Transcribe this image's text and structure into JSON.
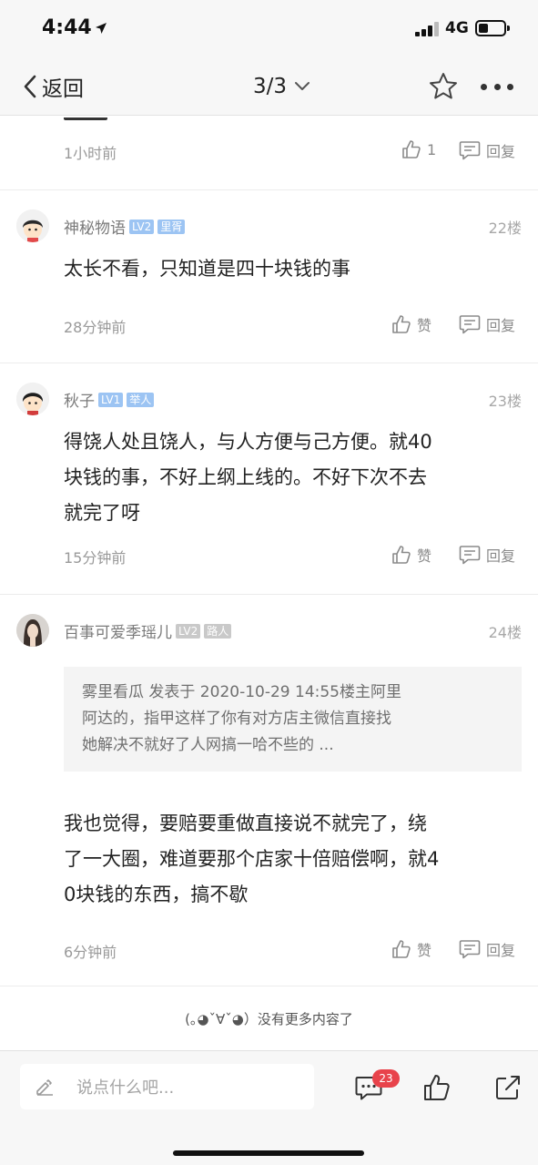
{
  "status": {
    "time": "4:44",
    "network": "4G"
  },
  "nav": {
    "back_label": "返回",
    "page": "3/3"
  },
  "comments": [
    {
      "time": "1小时前",
      "like": "1",
      "reply": "回复"
    },
    {
      "user": "神秘物语",
      "level": "LV2",
      "title": "里胥",
      "floor": "22楼",
      "text": "太长不看，只知道是四十块钱的事",
      "time": "28分钟前",
      "like": "赞",
      "reply": "回复"
    },
    {
      "user": "秋子",
      "level": "LV1",
      "title": "举人",
      "floor": "23楼",
      "text_lines": [
        "得饶人处且饶人，与人方便与己方便。就40",
        "块钱的事，不好上纲上线的。不好下次不去",
        "就完了呀"
      ],
      "time": "15分钟前",
      "like": "赞",
      "reply": "回复"
    },
    {
      "user": "百事可爱季瑶儿",
      "level": "LV2",
      "title": "路人",
      "floor": "24楼",
      "quote_lines": [
        "雾里看瓜 发表于 2020-10-29 14:55楼主阿里",
        "阿达的，指甲这样了你有对方店主微信直接找",
        "她解决不就好了人网搞一哈不些的 ..."
      ],
      "text_lines": [
        "我也觉得，要赔要重做直接说不就完了，绕",
        "了一大圈，难道要那个店家十倍赔偿啊，就4",
        "0块钱的东西，搞不歇"
      ],
      "time": "6分钟前",
      "like": "赞",
      "reply": "回复"
    }
  ],
  "end_text": "(｡◕ˇ∀ˇ◕）没有更多内容了",
  "bottom": {
    "input_placeholder": "说点什么吧...",
    "comment_count": "23"
  },
  "colors": {
    "level_badge": "#9cc4f3",
    "title_badge_gray": "#c9c9c9",
    "count_badge": "#e8434b"
  },
  "icons": [
    "location-arrow-icon",
    "signal-icon",
    "battery-icon",
    "back-chevron-icon",
    "chevron-down-icon",
    "star-icon",
    "more-icon",
    "thumb-up-icon",
    "reply-icon",
    "pencil-icon",
    "comment-icon",
    "share-icon"
  ]
}
